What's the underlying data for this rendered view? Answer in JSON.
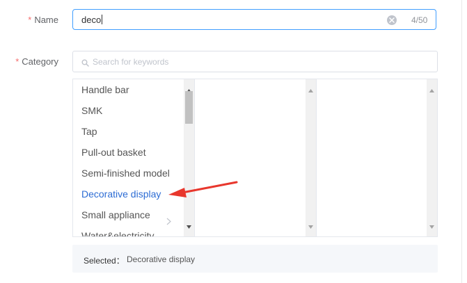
{
  "form": {
    "name": {
      "required_mark": "*",
      "label": "Name",
      "value": "deco",
      "counter": "4/50"
    },
    "category": {
      "required_mark": "*",
      "label": "Category",
      "search_placeholder": "Search for keywords",
      "columns": [
        {
          "items": [
            {
              "label": "Handle bar",
              "has_children": false
            },
            {
              "label": "SMK",
              "has_children": false
            },
            {
              "label": "Tap",
              "has_children": false
            },
            {
              "label": "Pull-out basket",
              "has_children": false
            },
            {
              "label": "Semi-finished model",
              "has_children": false
            },
            {
              "label": "Decorative display",
              "has_children": false,
              "active": true
            },
            {
              "label": "Small appliance",
              "has_children": true
            },
            {
              "label": "Water&electricity",
              "has_children": true
            }
          ]
        },
        {
          "items": []
        },
        {
          "items": []
        }
      ]
    },
    "selected": {
      "label": "Selected：",
      "value": "Decorative display"
    }
  },
  "colors": {
    "primary": "#409eff",
    "required": "#f56c6c",
    "active_item": "#2c6cd4",
    "annotation_arrow": "#e8372d"
  },
  "icons": {
    "clear": "clear-icon",
    "search": "search-icon",
    "chevron": "chevron-right-icon"
  }
}
